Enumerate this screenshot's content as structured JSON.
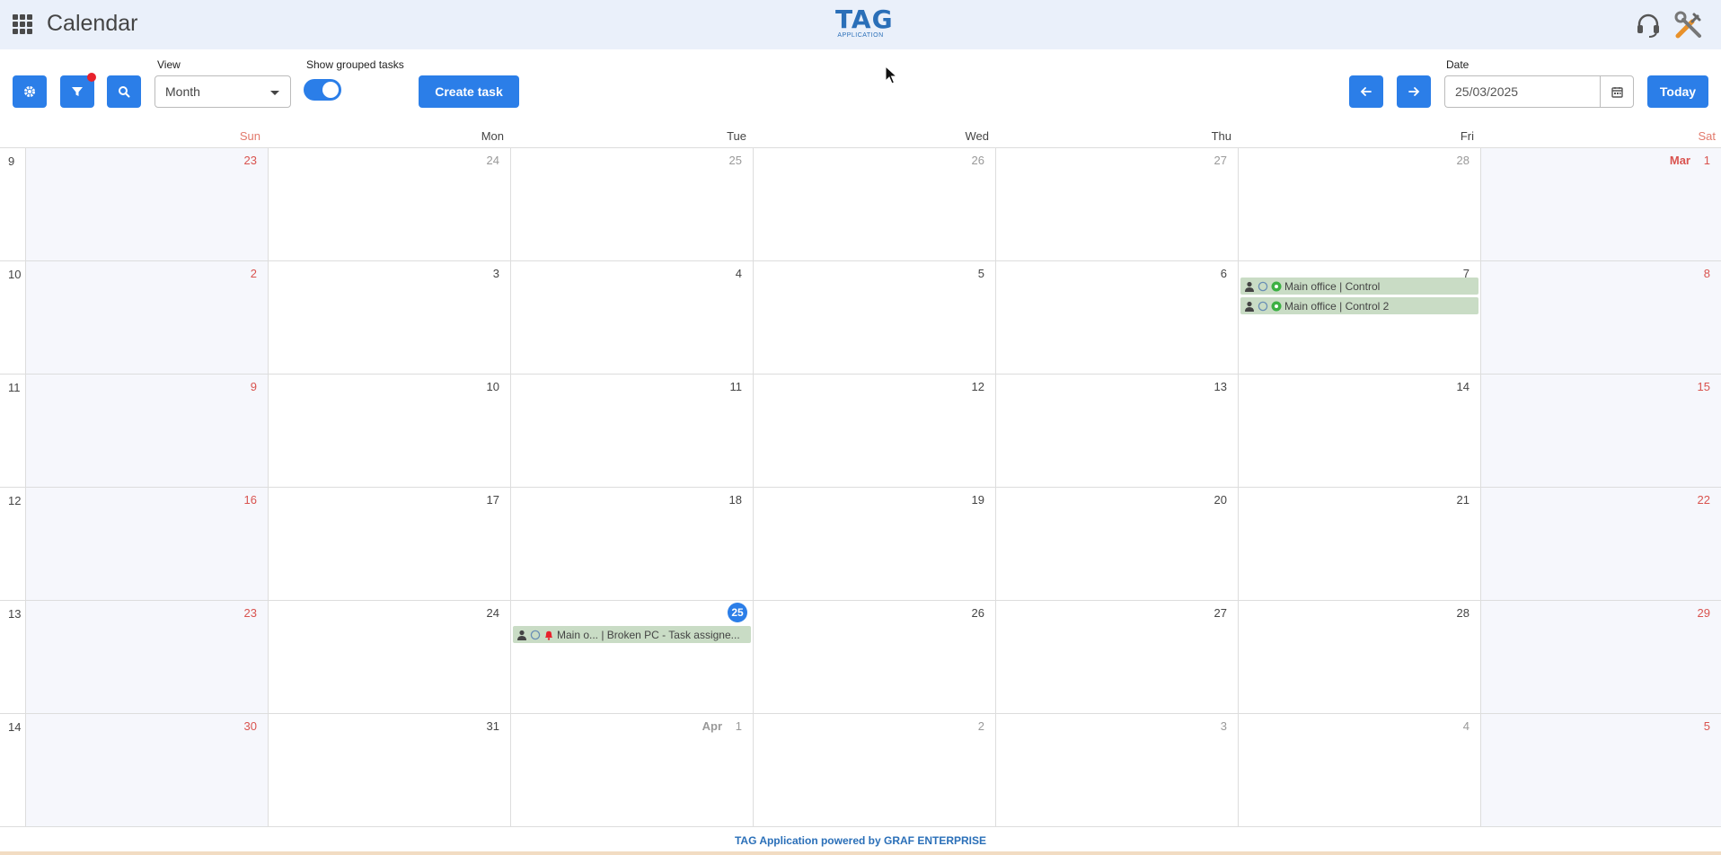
{
  "header": {
    "title": "Calendar",
    "logo_main": "TAG",
    "logo_sub": "APPLICATION",
    "apps_icon": "apps-grid-icon",
    "support_icon": "headset-icon",
    "tools_icon": "tools-icon"
  },
  "toolbar": {
    "settings_icon": "gear-icon",
    "filter_icon": "filter-icon",
    "search_icon": "search-icon",
    "view_label": "View",
    "view_value": "Month",
    "grouped_label": "Show grouped tasks",
    "grouped_on": true,
    "create_label": "Create task",
    "prev_icon": "arrow-left-icon",
    "next_icon": "arrow-right-icon",
    "date_label": "Date",
    "date_value": "25/03/2025",
    "today_label": "Today"
  },
  "calendar": {
    "days": [
      "Sun",
      "Mon",
      "Tue",
      "Wed",
      "Thu",
      "Fri",
      "Sat"
    ],
    "weeks": [
      {
        "num": "9",
        "days": [
          "23",
          "24",
          "25",
          "26",
          "27",
          "28",
          "1"
        ]
      },
      {
        "num": "10",
        "days": [
          "2",
          "3",
          "4",
          "5",
          "6",
          "7",
          "8"
        ]
      },
      {
        "num": "11",
        "days": [
          "9",
          "10",
          "11",
          "12",
          "13",
          "14",
          "15"
        ]
      },
      {
        "num": "12",
        "days": [
          "16",
          "17",
          "18",
          "19",
          "20",
          "21",
          "22"
        ]
      },
      {
        "num": "13",
        "days": [
          "23",
          "24",
          "25",
          "26",
          "27",
          "28",
          "29"
        ]
      },
      {
        "num": "14",
        "days": [
          "30",
          "31",
          "1",
          "2",
          "3",
          "4",
          "5"
        ]
      }
    ],
    "month_tags": {
      "mar": "Mar",
      "apr": "Apr"
    },
    "events": {
      "e1": "Main office | Control",
      "e2": "Main office | Control 2",
      "e3": "Main o...  | Broken PC - Task assigne..."
    }
  },
  "footer": {
    "text": "TAG Application powered by GRAF ENTERPRISE"
  },
  "colors": {
    "accent": "#2b7ee8",
    "weekend": "#d9534f",
    "event_bg": "#c9dcc5"
  }
}
